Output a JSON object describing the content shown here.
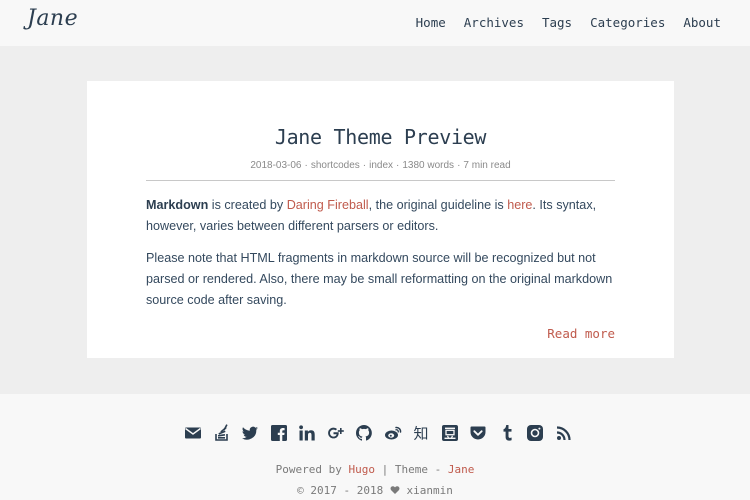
{
  "header": {
    "logo": "Jane",
    "nav": [
      "Home",
      "Archives",
      "Tags",
      "Categories",
      "About"
    ]
  },
  "post": {
    "title": "Jane Theme Preview",
    "meta": {
      "date": "2018-03-06",
      "categories": [
        "shortcodes",
        "index"
      ],
      "words": "1380 words",
      "read_time": "7 min read"
    },
    "p1": {
      "bold": "Markdown",
      "text_a": " is created by ",
      "link1": "Daring Fireball",
      "text_b": ", the original guideline is ",
      "link2": "here",
      "text_c": ". Its syntax, however, varies between different parsers or editors."
    },
    "p2": "Please note that HTML fragments in markdown source will be recognized but not parsed or rendered. Also, there may be small reformatting on the original markdown source code after saving.",
    "read_more": "Read more"
  },
  "footer": {
    "social_icons": [
      "email-icon",
      "stack-overflow-icon",
      "twitter-icon",
      "facebook-icon",
      "linkedin-icon",
      "google-plus-icon",
      "github-icon",
      "weibo-icon",
      "zhihu-icon",
      "douban-icon",
      "pocket-icon",
      "tumblr-icon",
      "instagram-icon",
      "rss-icon"
    ],
    "zhihu_glyph": "知",
    "powered_prefix": "Powered by ",
    "hugo": "Hugo",
    "theme_mid": " | Theme - ",
    "jane": "Jane",
    "copyright_years": "© 2017 - 2018",
    "author": "xianmin"
  },
  "colors": {
    "page_bg": "#eeeeee",
    "header_bg": "#f8f8f8",
    "text": "#34495e",
    "accent": "#c05b4d",
    "icon": "#2c3e50"
  }
}
